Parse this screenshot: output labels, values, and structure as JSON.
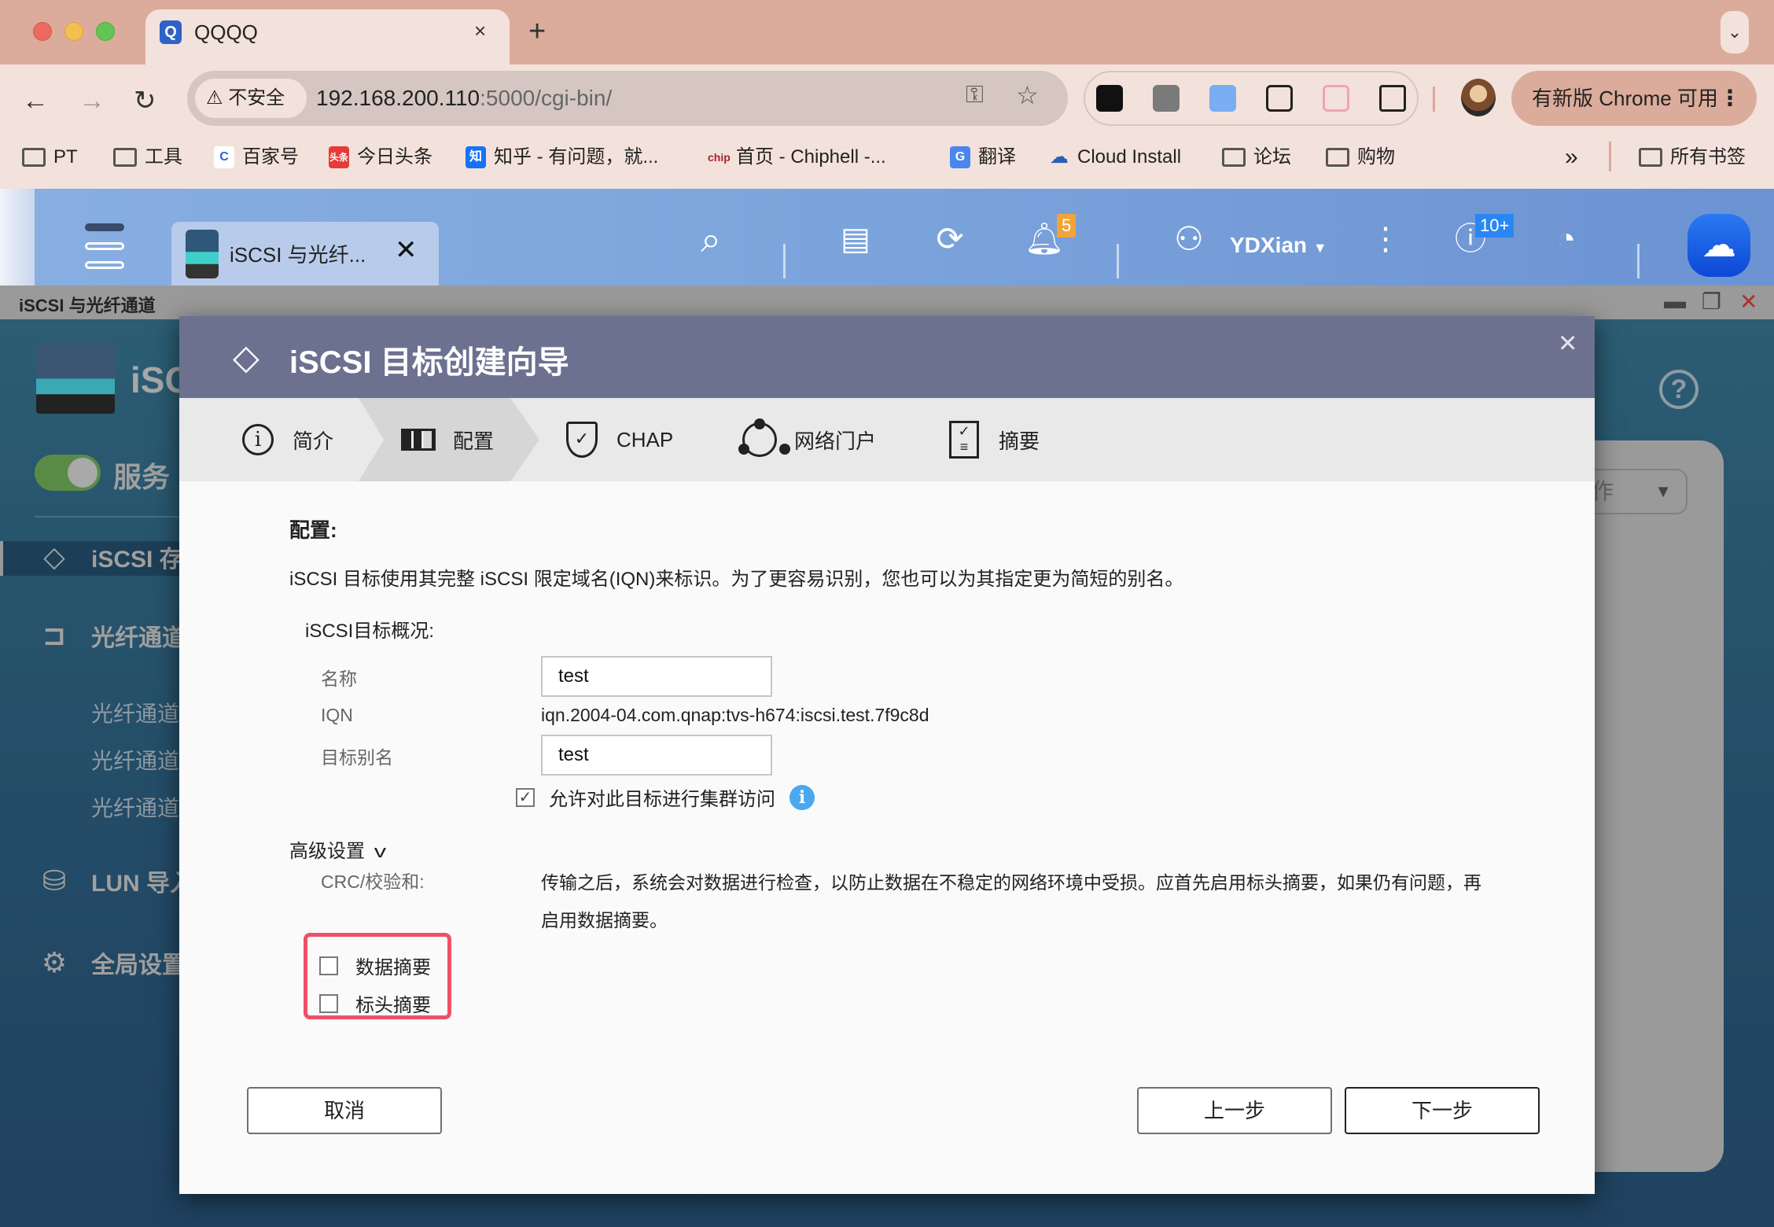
{
  "browser": {
    "tab_title": "QQQQ",
    "tab_close": "×",
    "new_tab": "+",
    "security_label": "不安全",
    "url_host": "192.168.200.110",
    "url_path": ":5000/cgi-bin/",
    "update_label": "有新版 Chrome 可用",
    "bookmarks": [
      {
        "label": "PT",
        "icon": "folder"
      },
      {
        "label": "工具",
        "icon": "folder"
      },
      {
        "label": "百家号",
        "icon": "baijiahao"
      },
      {
        "label": "今日头条",
        "icon": "toutiao"
      },
      {
        "label": "知乎 - 有问题，就...",
        "icon": "zhihu"
      },
      {
        "label": "首页 - Chiphell -...",
        "icon": "chiphell"
      },
      {
        "label": "翻译",
        "icon": "google-translate"
      },
      {
        "label": "Cloud Install",
        "icon": "cloud"
      },
      {
        "label": "论坛",
        "icon": "folder"
      },
      {
        "label": "购物",
        "icon": "folder"
      }
    ],
    "bookmarks_overflow": "»",
    "all_bookmarks": "所有书签"
  },
  "qts": {
    "app_tab_title": "iSCSI 与光纤...",
    "notification_count": "5",
    "user_name": "YDXian",
    "info_count": "10+"
  },
  "window": {
    "title": "iSCSI 与光纤通道"
  },
  "app": {
    "logo_text": "iSC",
    "service_label": "服务",
    "service_enabled": true,
    "sidebar": [
      {
        "label": "iSCSI 存",
        "icon": "iscsi-storage",
        "active": true
      },
      {
        "label": "光纤通道",
        "icon": "fibre-channel"
      },
      {
        "label": "LUN 导入",
        "icon": "lun-import"
      },
      {
        "label": "全局设置",
        "icon": "gear"
      }
    ],
    "sidebar_sub": [
      "光纤通道",
      "光纤通道",
      "光纤通道"
    ],
    "action_select_partial": "作"
  },
  "wizard": {
    "title": "iSCSI 目标创建向导",
    "close": "×",
    "steps": [
      {
        "label": "简介",
        "icon": "info"
      },
      {
        "label": "配置",
        "icon": "config",
        "active": true
      },
      {
        "label": "CHAP",
        "icon": "shield-check"
      },
      {
        "label": "网络门户",
        "icon": "network-portal"
      },
      {
        "label": "摘要",
        "icon": "clipboard"
      }
    ],
    "section_title": "配置:",
    "intro": "iSCSI 目标使用其完整 iSCSI 限定域名(IQN)来标识。为了更容易识别，您也可以为其指定更为简短的别名。",
    "overview_title": "iSCSI目标概况:",
    "fields": {
      "name_label": "名称",
      "name_value": "test",
      "iqn_label": "IQN",
      "iqn_value": "iqn.2004-04.com.qnap:tvs-h674:iscsi.test.7f9c8d",
      "alias_label": "目标别名",
      "alias_value": "test"
    },
    "cluster_access_label": "允许对此目标进行集群访问",
    "cluster_access_checked": true,
    "advanced_title": "高级设置",
    "crc_label": "CRC/校验和:",
    "crc_description": "传输之后，系统会对数据进行检查，以防止数据在不稳定的网络环境中受损。应首先启用标头摘要，如果仍有问题，再启用数据摘要。",
    "data_digest_label": "数据摘要",
    "data_digest_checked": false,
    "header_digest_label": "标头摘要",
    "header_digest_checked": false,
    "buttons": {
      "cancel": "取消",
      "prev": "上一步",
      "next": "下一步"
    }
  },
  "colors": {
    "modal_header": "#6c7190",
    "highlight": "#ef5068",
    "accent_blue": "#2a86f3",
    "badge_orange": "#f1a43a"
  }
}
